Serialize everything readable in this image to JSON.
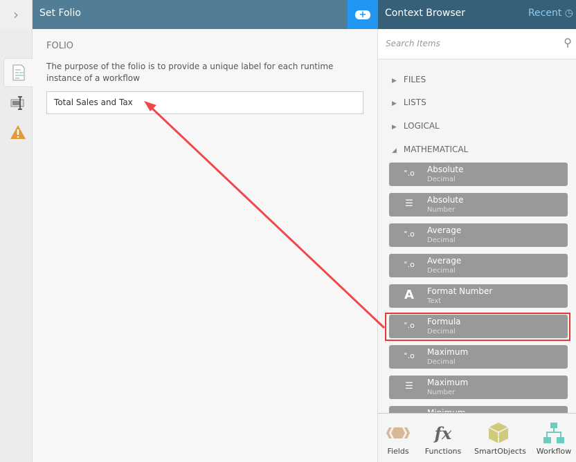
{
  "header": {
    "chevron": "›",
    "title": "Set Folio",
    "add_icon": "+",
    "context_title": "Context Browser",
    "recent_label": "Recent"
  },
  "folio": {
    "heading": "FOLIO",
    "description": "The purpose of the folio is to provide a unique label for each runtime instance of a workflow",
    "value": "Total Sales and Tax"
  },
  "search": {
    "placeholder": "Search Items"
  },
  "groups": [
    {
      "label": "FILES",
      "arrow": "▶"
    },
    {
      "label": "LISTS",
      "arrow": "▶"
    },
    {
      "label": "LOGICAL",
      "arrow": "▶"
    },
    {
      "label": "MATHEMATICAL",
      "arrow": "◢"
    }
  ],
  "items": [
    {
      "name": "Absolute",
      "type": "Decimal",
      "icon": "decimal-icon"
    },
    {
      "name": "Absolute",
      "type": "Number",
      "icon": "number-list-icon"
    },
    {
      "name": "Average",
      "type": "Decimal",
      "icon": "decimal-icon"
    },
    {
      "name": "Average",
      "type": "Decimal",
      "icon": "decimal-icon"
    },
    {
      "name": "Format Number",
      "type": "Text",
      "icon": "text-icon"
    },
    {
      "name": "Formula",
      "type": "Decimal",
      "icon": "decimal-icon"
    },
    {
      "name": "Maximum",
      "type": "Decimal",
      "icon": "decimal-icon"
    },
    {
      "name": "Maximum",
      "type": "Number",
      "icon": "number-list-icon"
    },
    {
      "name": "Minimum",
      "type": "",
      "icon": "decimal-icon"
    }
  ],
  "bottom": [
    {
      "label": "Fields"
    },
    {
      "label": "Functions"
    },
    {
      "label": "SmartObjects"
    },
    {
      "label": "Workflow"
    }
  ],
  "colors": {
    "header": "#517d96",
    "context_header": "#365f78",
    "accent": "#2196f3",
    "highlight": "#e53935"
  }
}
